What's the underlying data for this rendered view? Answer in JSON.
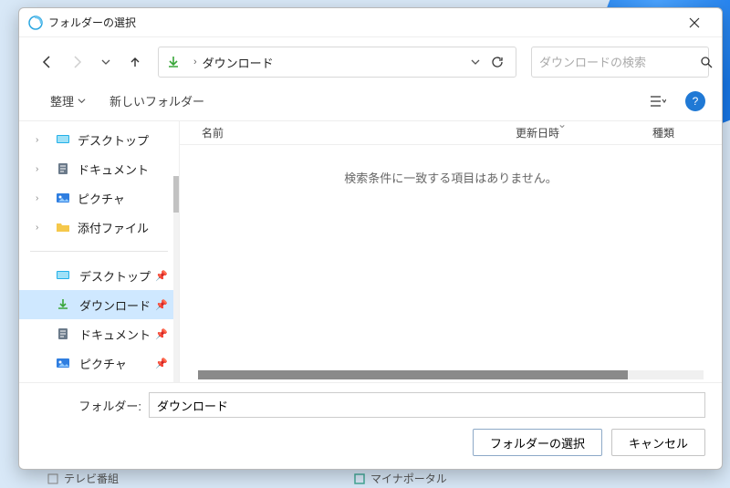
{
  "window": {
    "title": "フォルダーの選択"
  },
  "nav": {
    "crumb": "ダウンロード"
  },
  "search": {
    "placeholder": "ダウンロードの検索"
  },
  "toolbar": {
    "organize": "整理",
    "new_folder": "新しいフォルダー"
  },
  "tree": [
    {
      "label": "デスクトップ",
      "icon": "desktop"
    },
    {
      "label": "ドキュメント",
      "icon": "document"
    },
    {
      "label": "ピクチャ",
      "icon": "picture"
    },
    {
      "label": "添付ファイル",
      "icon": "folder"
    }
  ],
  "favorites": [
    {
      "label": "デスクトップ",
      "icon": "desktop",
      "selected": false
    },
    {
      "label": "ダウンロード",
      "icon": "download",
      "selected": true
    },
    {
      "label": "ドキュメント",
      "icon": "document",
      "selected": false
    },
    {
      "label": "ピクチャ",
      "icon": "picture",
      "selected": false
    }
  ],
  "columns": {
    "name": "名前",
    "date": "更新日時",
    "type": "種類"
  },
  "empty_text": "検索条件に一致する項目はありません。",
  "footer": {
    "folder_label": "フォルダー:",
    "folder_value": "ダウンロード",
    "select_btn": "フォルダーの選択",
    "cancel_btn": "キャンセル"
  },
  "below": {
    "item1": "テレビ番組",
    "item2": "マイナポータル"
  }
}
